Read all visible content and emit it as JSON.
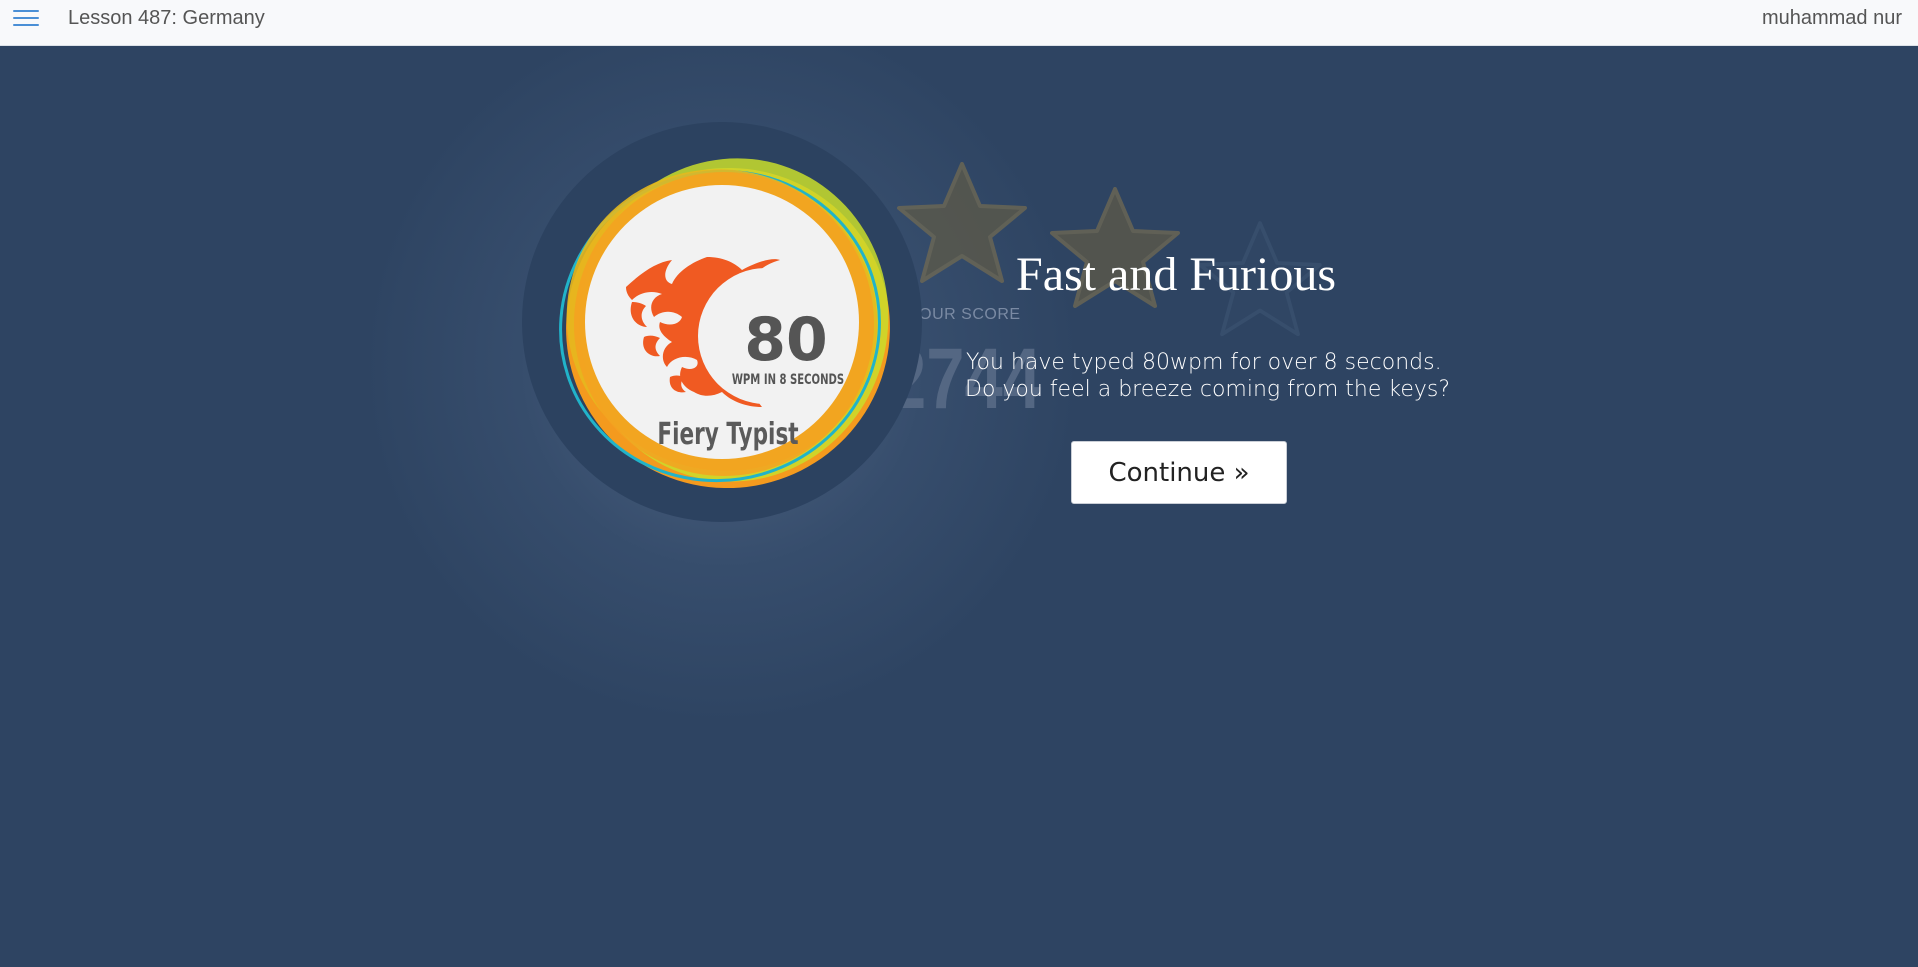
{
  "header": {
    "menu_icon": "hamburger-menu-icon",
    "lesson_title": "Lesson 487: Germany",
    "user_name": "muhammad nur"
  },
  "score": {
    "label": "YOUR SCORE",
    "value": "2744",
    "stars_earned": 3,
    "stars_total": 4
  },
  "badge": {
    "number": "80",
    "subtitle": "WPM IN 8 SECONDS",
    "name": "Fiery Typist",
    "icon": "flame-icon"
  },
  "popup": {
    "title": "Fast and Furious",
    "line1": "You have typed 80wpm for over 8 seconds.",
    "line2": "Do you feel a breeze coming from the keys?",
    "continue_label": "Continue »"
  },
  "colors": {
    "background": "#2e4462",
    "header_bg": "#f8f9fb",
    "accent_blue": "#4a8fd6",
    "flame": "#f05a22",
    "star_earned": "#6b6246",
    "star_empty": "#3a4f6c"
  }
}
